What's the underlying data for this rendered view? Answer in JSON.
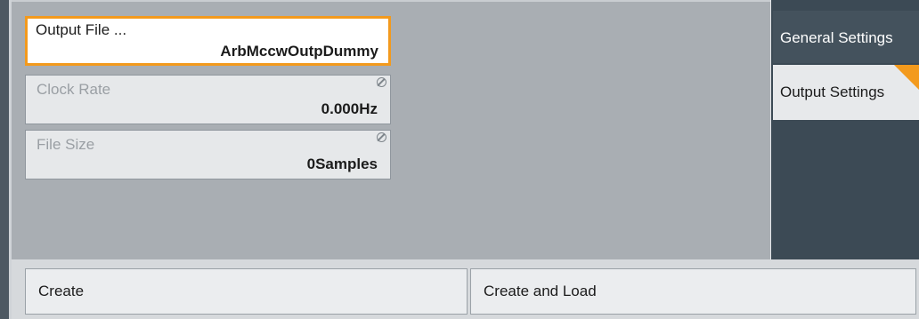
{
  "fields": {
    "output_file": {
      "label": "Output File ...",
      "value": "ArbMccwOutpDummy"
    },
    "clock_rate": {
      "label": "Clock Rate",
      "value": "0.000Hz"
    },
    "file_size": {
      "label": "File Size",
      "value": "0Samples"
    }
  },
  "side_tabs": {
    "general": "General Settings",
    "output": "Output Settings"
  },
  "buttons": {
    "create": "Create",
    "create_and_load": "Create and Load"
  },
  "colors": {
    "accent": "#f39a1d",
    "panel_dark": "#3c4a55",
    "content_bg": "#a9aeb3"
  },
  "icons": {
    "readonly": "readonly-icon"
  }
}
